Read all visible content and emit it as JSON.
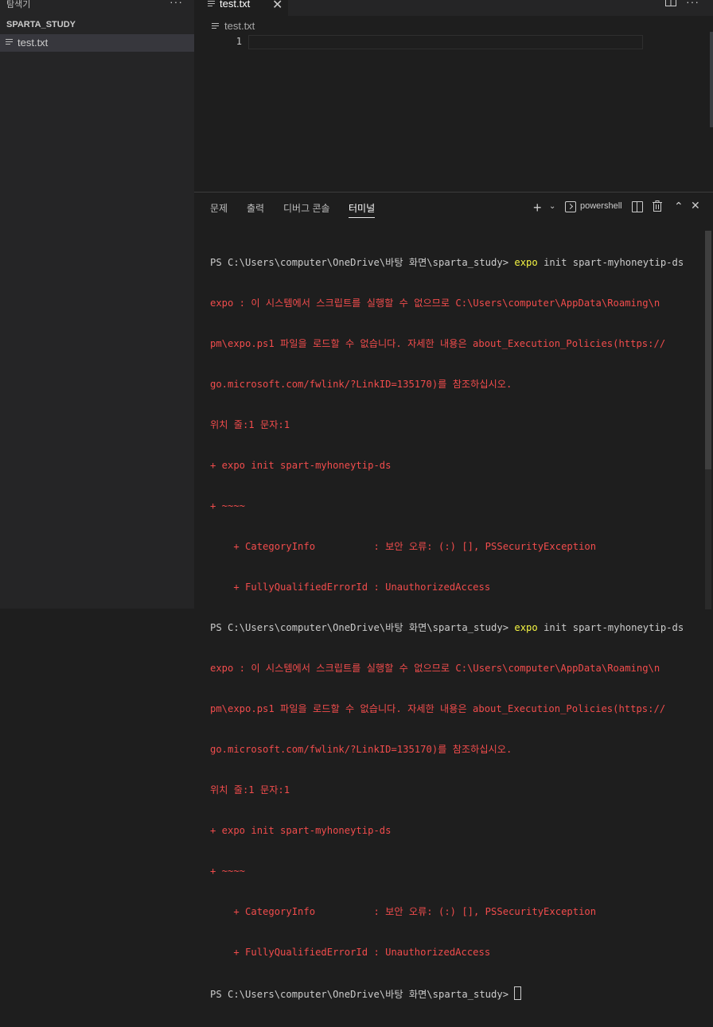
{
  "sidebar": {
    "title": "탐색기",
    "more": "···",
    "folder": "SPARTA_STUDY",
    "files": [
      "test.txt"
    ]
  },
  "tabs": {
    "active": "test.txt",
    "close": "✕",
    "more": "···"
  },
  "breadcrumb": "test.txt",
  "editor": {
    "line_number": "1"
  },
  "panel": {
    "tabs": [
      "문제",
      "출력",
      "디버그 콘솔",
      "터미널"
    ],
    "active_tab": "터미널",
    "plus": "+",
    "chevron": "⌄",
    "terminal_name": "powershell",
    "maximize": "⌃",
    "close": "✕"
  },
  "terminal": {
    "prompt": "PS C:\\Users\\computer\\OneDrive\\바탕 화면\\sparta_study> ",
    "command": "expo",
    "command_args": " init spart-myhoneytip-ds",
    "error_lines": [
      "expo : 이 시스템에서 스크립트를 실행할 수 없으므로 C:\\Users\\computer\\AppData\\Roaming\\n",
      "pm\\expo.ps1 파일을 로드할 수 없습니다. 자세한 내용은 about_Execution_Policies(https://",
      "go.microsoft.com/fwlink/?LinkID=135170)를 참조하십시오.",
      "위치 줄:1 문자:1",
      "+ expo init spart-myhoneytip-ds",
      "+ ~~~~",
      "    + CategoryInfo          : 보안 오류: (:) [], PSSecurityException",
      "    + FullyQualifiedErrorId : UnauthorizedAccess"
    ]
  },
  "colors": {
    "error": "#f14c4c",
    "command": "#f5f543",
    "background": "#1e1e1e",
    "sidebar": "#252526"
  }
}
